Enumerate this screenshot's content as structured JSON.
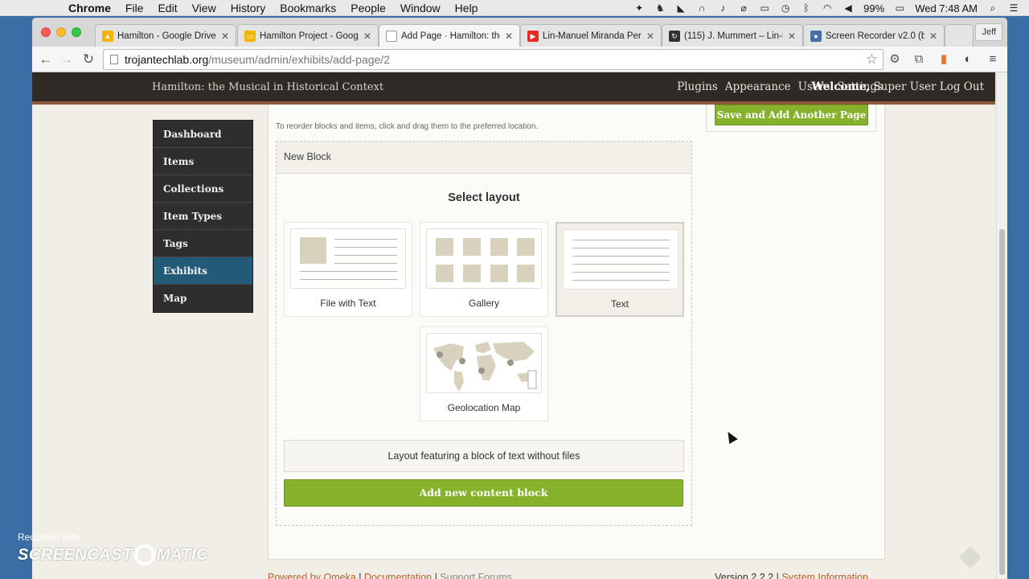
{
  "menubar": {
    "app_name": "Chrome",
    "items": [
      "File",
      "Edit",
      "View",
      "History",
      "Bookmarks",
      "People",
      "Window",
      "Help"
    ],
    "battery": "99%",
    "clock": "Wed 7:48 AM"
  },
  "browser": {
    "tabs": [
      {
        "label": "Hamilton - Google Drive",
        "icon": "google-drive-icon",
        "color": "#f6b400"
      },
      {
        "label": "Hamilton Project - Googl",
        "icon": "google-slides-icon",
        "color": "#f4b400"
      },
      {
        "label": "Add Page · Hamilton: the",
        "icon": "page-icon",
        "color": "#ffffff"
      },
      {
        "label": "Lin-Manuel Miranda Perf",
        "icon": "youtube-icon",
        "color": "#e52d27"
      },
      {
        "label": "(115) J. Mummert – Lin-M",
        "icon": "mummert-icon",
        "color": "#333333"
      },
      {
        "label": "Screen Recorder v2.0 (be",
        "icon": "screen-recorder-icon",
        "color": "#4a6fa5"
      }
    ],
    "profile": "Jeff",
    "url_host": "trojantechlab.org",
    "url_path": "/museum/admin/exhibits/add-page/2"
  },
  "admin_bar": {
    "site_title": "Hamilton: the Musical in Historical Context",
    "nav": [
      "Plugins",
      "Appearance",
      "Users",
      "Settings"
    ],
    "welcome_label": "Welcome,",
    "user_name": "Super User",
    "logout": "Log Out"
  },
  "sidebar": {
    "items": [
      {
        "label": "Dashboard",
        "active": false
      },
      {
        "label": "Items",
        "active": false
      },
      {
        "label": "Collections",
        "active": false
      },
      {
        "label": "Item Types",
        "active": false
      },
      {
        "label": "Tags",
        "active": false
      },
      {
        "label": "Exhibits",
        "active": true
      },
      {
        "label": "Map",
        "active": false
      }
    ]
  },
  "main": {
    "hint": "To reorder blocks and items, click and drag them to the preferred location.",
    "block_title": "New Block",
    "select_layout_title": "Select layout",
    "layouts": [
      {
        "name": "File with Text",
        "selected": false
      },
      {
        "name": "Gallery",
        "selected": false
      },
      {
        "name": "Text",
        "selected": true
      },
      {
        "name": "Geolocation Map",
        "selected": false
      }
    ],
    "layout_description": "Layout featuring a block of text without files",
    "add_block_button": "Add new content block",
    "save_add_button": "Save and Add Another Page"
  },
  "footer": {
    "powered_by": "Powered by Omeka",
    "documentation": "Documentation",
    "support": "Support Forums",
    "version": "Version 2.2.2",
    "system_info": "System Information",
    "sep": "|"
  },
  "watermark": {
    "recorded_with": "Recorded with",
    "brand_left": "SCREENCAST",
    "brand_right": "MATIC"
  }
}
